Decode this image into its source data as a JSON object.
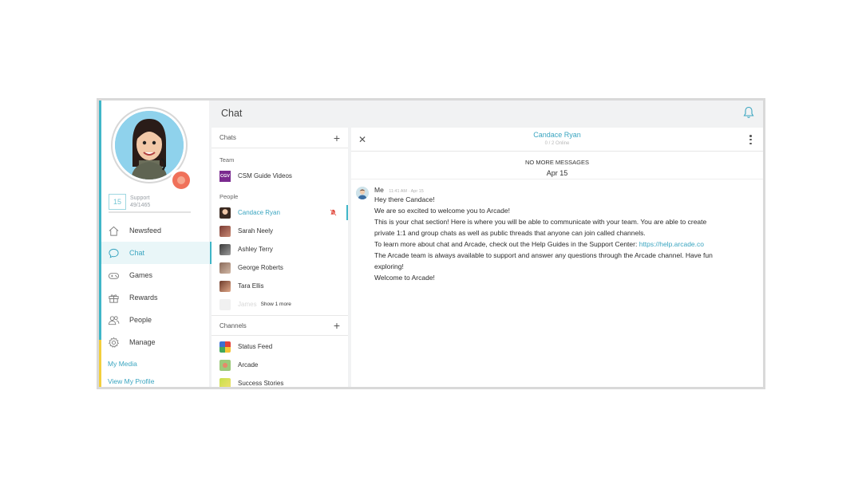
{
  "header": {
    "title": "Chat"
  },
  "profile": {
    "level": "15",
    "level_label": "Support",
    "level_progress_text": "49/1465"
  },
  "nav": {
    "items": [
      {
        "label": "Newsfeed",
        "icon": "home-icon"
      },
      {
        "label": "Chat",
        "icon": "chat-icon",
        "active": true
      },
      {
        "label": "Games",
        "icon": "gamepad-icon"
      },
      {
        "label": "Rewards",
        "icon": "gift-icon"
      },
      {
        "label": "People",
        "icon": "people-icon"
      },
      {
        "label": "Manage",
        "icon": "gear-icon"
      }
    ],
    "my_media": "My Media",
    "view_profile": "View My Profile"
  },
  "chats": {
    "title": "Chats",
    "team_label": "Team",
    "team": [
      {
        "name": "CSM Guide Videos",
        "badge": "CGV"
      }
    ],
    "people_label": "People",
    "people": [
      {
        "name": "Candace Ryan",
        "active": true,
        "muted": true
      },
      {
        "name": "Sarah Neely"
      },
      {
        "name": "Ashley Terry"
      },
      {
        "name": "George Roberts"
      },
      {
        "name": "Tara Ellis"
      }
    ],
    "ghost_name": "James",
    "show_more": "Show 1 more",
    "channels_label": "Channels",
    "channels": [
      {
        "name": "Status Feed"
      },
      {
        "name": "Arcade"
      },
      {
        "name": "Success Stories"
      }
    ]
  },
  "conversation": {
    "title": "Candace Ryan",
    "subtitle": "0 / 2 Online",
    "no_more": "NO MORE MESSAGES",
    "date": "Apr 15",
    "message": {
      "author": "Me",
      "time": "11:41 AM · Apr 15",
      "lines": [
        "Hey there Candace!",
        "We are so excited to welcome you to Arcade!",
        "This is your chat section! Here is where you will be able to communicate with your team. You are able to create",
        "private 1:1 and group chats as well as public threads that anyone can join called channels.",
        "To learn more about chat and Arcade, check out the Help Guides in the Support Center:",
        "The Arcade team is always available to support and answer any questions through the Arcade channel. Have fun",
        "exploring!",
        "Welcome to Arcade!"
      ],
      "link": "https://help.arcade.co"
    }
  },
  "colors": {
    "accent": "#3aa5c0",
    "mute": "#e0463a"
  }
}
